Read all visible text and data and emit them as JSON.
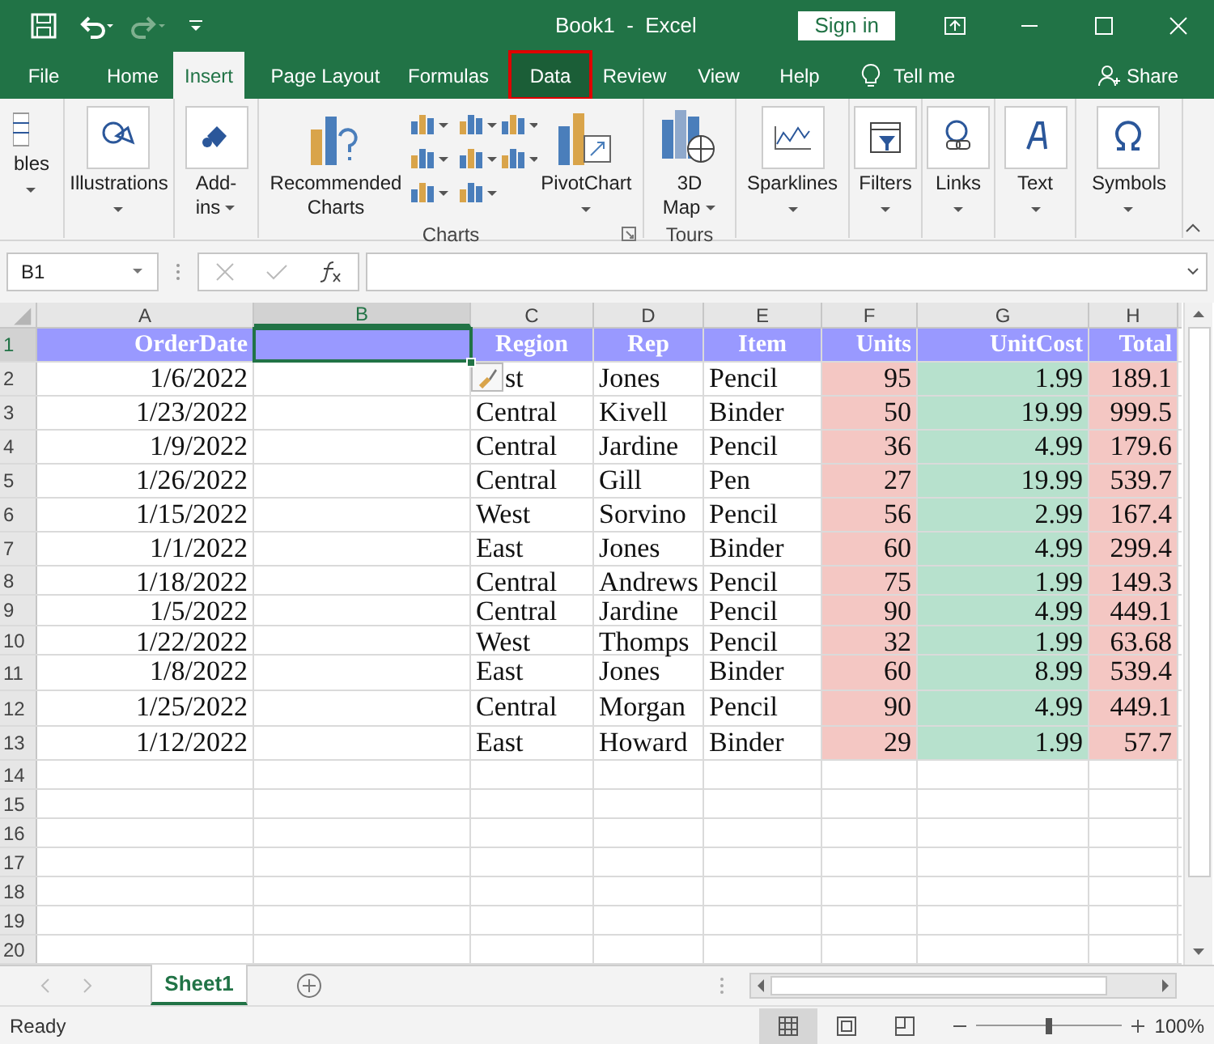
{
  "window": {
    "title": "Book1  -  Excel",
    "sign_in": "Sign in"
  },
  "tabs": [
    {
      "label": "File",
      "selected": false,
      "highlighted": false
    },
    {
      "label": "Home",
      "selected": false,
      "highlighted": false
    },
    {
      "label": "Insert",
      "selected": true,
      "highlighted": false
    },
    {
      "label": "Page Layout",
      "selected": false,
      "highlighted": false
    },
    {
      "label": "Formulas",
      "selected": false,
      "highlighted": false
    },
    {
      "label": "Data",
      "selected": false,
      "highlighted": true
    },
    {
      "label": "Review",
      "selected": false,
      "highlighted": false
    },
    {
      "label": "View",
      "selected": false,
      "highlighted": false
    },
    {
      "label": "Help",
      "selected": false,
      "highlighted": false
    }
  ],
  "tell_me": "Tell me",
  "share": "Share",
  "ribbon": {
    "groups": [
      {
        "items": [
          {
            "kind": "table",
            "lines": [
              "bles"
            ],
            "caret": true
          }
        ]
      },
      {
        "items": [
          {
            "kind": "shapes",
            "lines": [
              "Illustrations"
            ],
            "caret": true
          }
        ]
      },
      {
        "items": [
          {
            "kind": "addins",
            "lines": [
              "Add-",
              "ins"
            ],
            "caret": true
          }
        ]
      },
      {
        "label": "Charts",
        "items": [
          {
            "kind": "recommended",
            "lines": [
              "Recommended",
              "Charts"
            ],
            "caret": false
          },
          {
            "kind": "chart-grid"
          },
          {
            "kind": "pivot",
            "lines": [
              "PivotChart"
            ],
            "caret": true
          }
        ]
      },
      {
        "label": "Tours",
        "items": [
          {
            "kind": "map",
            "lines": [
              "3D",
              "Map"
            ],
            "caret": true
          }
        ]
      },
      {
        "items": [
          {
            "kind": "sparkline",
            "lines": [
              "Sparklines"
            ],
            "caret": true
          }
        ]
      },
      {
        "items": [
          {
            "kind": "filter",
            "lines": [
              "Filters"
            ],
            "caret": true
          }
        ]
      },
      {
        "items": [
          {
            "kind": "link",
            "lines": [
              "Links"
            ],
            "caret": true
          }
        ]
      },
      {
        "items": [
          {
            "kind": "text",
            "lines": [
              "Text"
            ],
            "caret": true
          }
        ]
      },
      {
        "items": [
          {
            "kind": "symbol",
            "lines": [
              "Symbols"
            ],
            "caret": true
          }
        ]
      }
    ]
  },
  "name_box": "B1",
  "columns": [
    {
      "letter": "A",
      "selected": false
    },
    {
      "letter": "B",
      "selected": true
    },
    {
      "letter": "C",
      "selected": false
    },
    {
      "letter": "D",
      "selected": false
    },
    {
      "letter": "E",
      "selected": false
    },
    {
      "letter": "F",
      "selected": false,
      "color": "#f4c7c3"
    },
    {
      "letter": "G",
      "selected": false,
      "color": "#b7e1cd"
    },
    {
      "letter": "H",
      "selected": false,
      "color": "#f4c7c3"
    }
  ],
  "rows": [
    {
      "number": "1",
      "selected": true,
      "kind": "header",
      "cells": [
        "OrderDate",
        null,
        "Region",
        "Rep",
        "Item",
        "Units",
        "UnitCost",
        "Total"
      ]
    },
    {
      "number": "2",
      "selected": false,
      "kind": "data",
      "cells": [
        "1/6/2022",
        null,
        "st",
        "Jones",
        "Pencil",
        "95",
        "1.99",
        "189.1"
      ]
    },
    {
      "number": "3",
      "selected": false,
      "kind": "data",
      "cells": [
        "1/23/2022",
        null,
        "Central",
        "Kivell",
        "Binder",
        "50",
        "19.99",
        "999.5"
      ]
    },
    {
      "number": "4",
      "selected": false,
      "kind": "data",
      "cells": [
        "1/9/2022",
        null,
        "Central",
        "Jardine",
        "Pencil",
        "36",
        "4.99",
        "179.6"
      ]
    },
    {
      "number": "5",
      "selected": false,
      "kind": "data",
      "cells": [
        "1/26/2022",
        null,
        "Central",
        "Gill",
        "Pen",
        "27",
        "19.99",
        "539.7"
      ]
    },
    {
      "number": "6",
      "selected": false,
      "kind": "data",
      "cells": [
        "1/15/2022",
        null,
        "West",
        "Sorvino",
        "Pencil",
        "56",
        "2.99",
        "167.4"
      ]
    },
    {
      "number": "7",
      "selected": false,
      "kind": "data",
      "cells": [
        "1/1/2022",
        null,
        "East",
        "Jones",
        "Binder",
        "60",
        "4.99",
        "299.4"
      ]
    },
    {
      "number": "8",
      "selected": false,
      "kind": "data",
      "cells": [
        "1/18/2022",
        null,
        "Central",
        "Andrews",
        "Pencil",
        "75",
        "1.99",
        "149.3"
      ]
    },
    {
      "number": "9",
      "selected": false,
      "kind": "data",
      "cells": [
        "1/5/2022",
        null,
        "Central",
        "Jardine",
        "Pencil",
        "90",
        "4.99",
        "449.1"
      ]
    },
    {
      "number": "10",
      "selected": false,
      "kind": "data",
      "cells": [
        "1/22/2022",
        null,
        "West",
        "Thomps",
        "Pencil",
        "32",
        "1.99",
        "63.68"
      ]
    },
    {
      "number": "11",
      "selected": false,
      "kind": "data",
      "cells": [
        "1/8/2022",
        null,
        "East",
        "Jones",
        "Binder",
        "60",
        "8.99",
        "539.4"
      ]
    },
    {
      "number": "12",
      "selected": false,
      "kind": "data",
      "cells": [
        "1/25/2022",
        null,
        "Central",
        "Morgan",
        "Pencil",
        "90",
        "4.99",
        "449.1"
      ]
    },
    {
      "number": "13",
      "selected": false,
      "kind": "data",
      "cells": [
        "1/12/2022",
        null,
        "East",
        "Howard",
        "Binder",
        "29",
        "1.99",
        "57.7"
      ]
    },
    {
      "number": "14",
      "selected": false,
      "kind": "empty"
    },
    {
      "number": "15",
      "selected": false,
      "kind": "empty"
    },
    {
      "number": "16",
      "selected": false,
      "kind": "empty"
    },
    {
      "number": "17",
      "selected": false,
      "kind": "empty"
    },
    {
      "number": "18",
      "selected": false,
      "kind": "empty"
    },
    {
      "number": "19",
      "selected": false,
      "kind": "empty"
    },
    {
      "number": "20",
      "selected": false,
      "kind": "empty"
    }
  ],
  "sheets": [
    {
      "label": "Sheet1",
      "selected": true
    }
  ],
  "status": {
    "text": "Ready",
    "zoom": "100%",
    "level": 0.5
  }
}
